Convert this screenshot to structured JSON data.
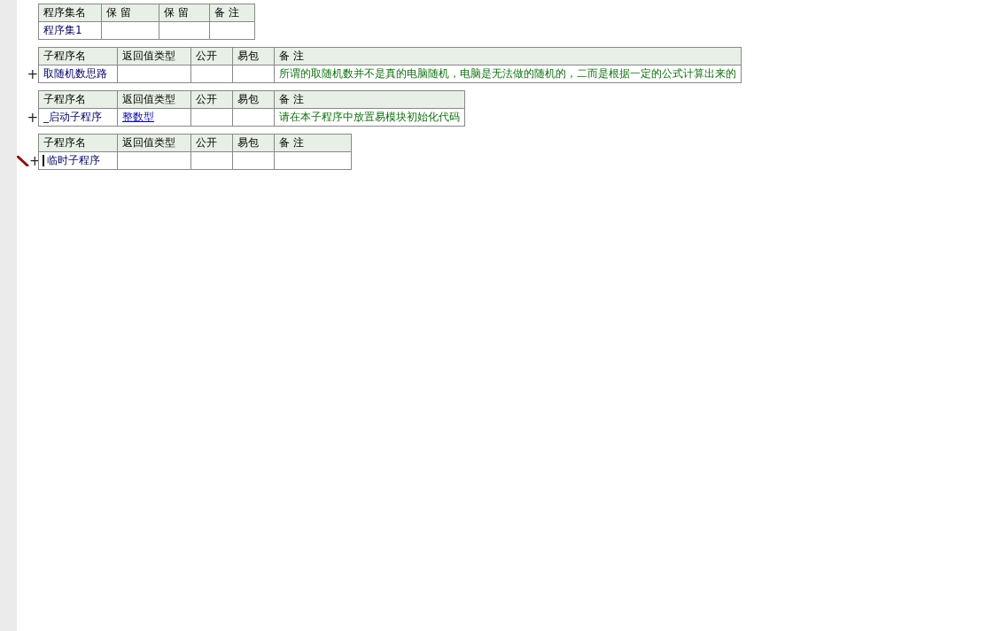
{
  "assembly": {
    "columns": [
      "程序集名",
      "保 留",
      "保 留",
      "备 注"
    ],
    "row": {
      "name": "程序集1"
    }
  },
  "subroutines": [
    {
      "expand": "+",
      "editing": false,
      "columns": [
        "子程序名",
        "返回值类型",
        "公开",
        "易包",
        "备 注"
      ],
      "row": {
        "name": "取随机数思路",
        "note": "所谓的取随机数并不是真的电脑随机，电脑是无法做的随机的，二而是根据一定的公式计算出来的"
      }
    },
    {
      "expand": "+",
      "editing": false,
      "columns": [
        "子程序名",
        "返回值类型",
        "公开",
        "易包",
        "备 注"
      ],
      "row": {
        "name": "_启动子程序",
        "return_type": "整数型",
        "note": "请在本子程序中放置易模块初始化代码"
      }
    },
    {
      "expand": "+",
      "editing": true,
      "columns": [
        "子程序名",
        "返回值类型",
        "公开",
        "易包",
        "备 注"
      ],
      "row": {
        "name": "临时子程序"
      }
    }
  ]
}
